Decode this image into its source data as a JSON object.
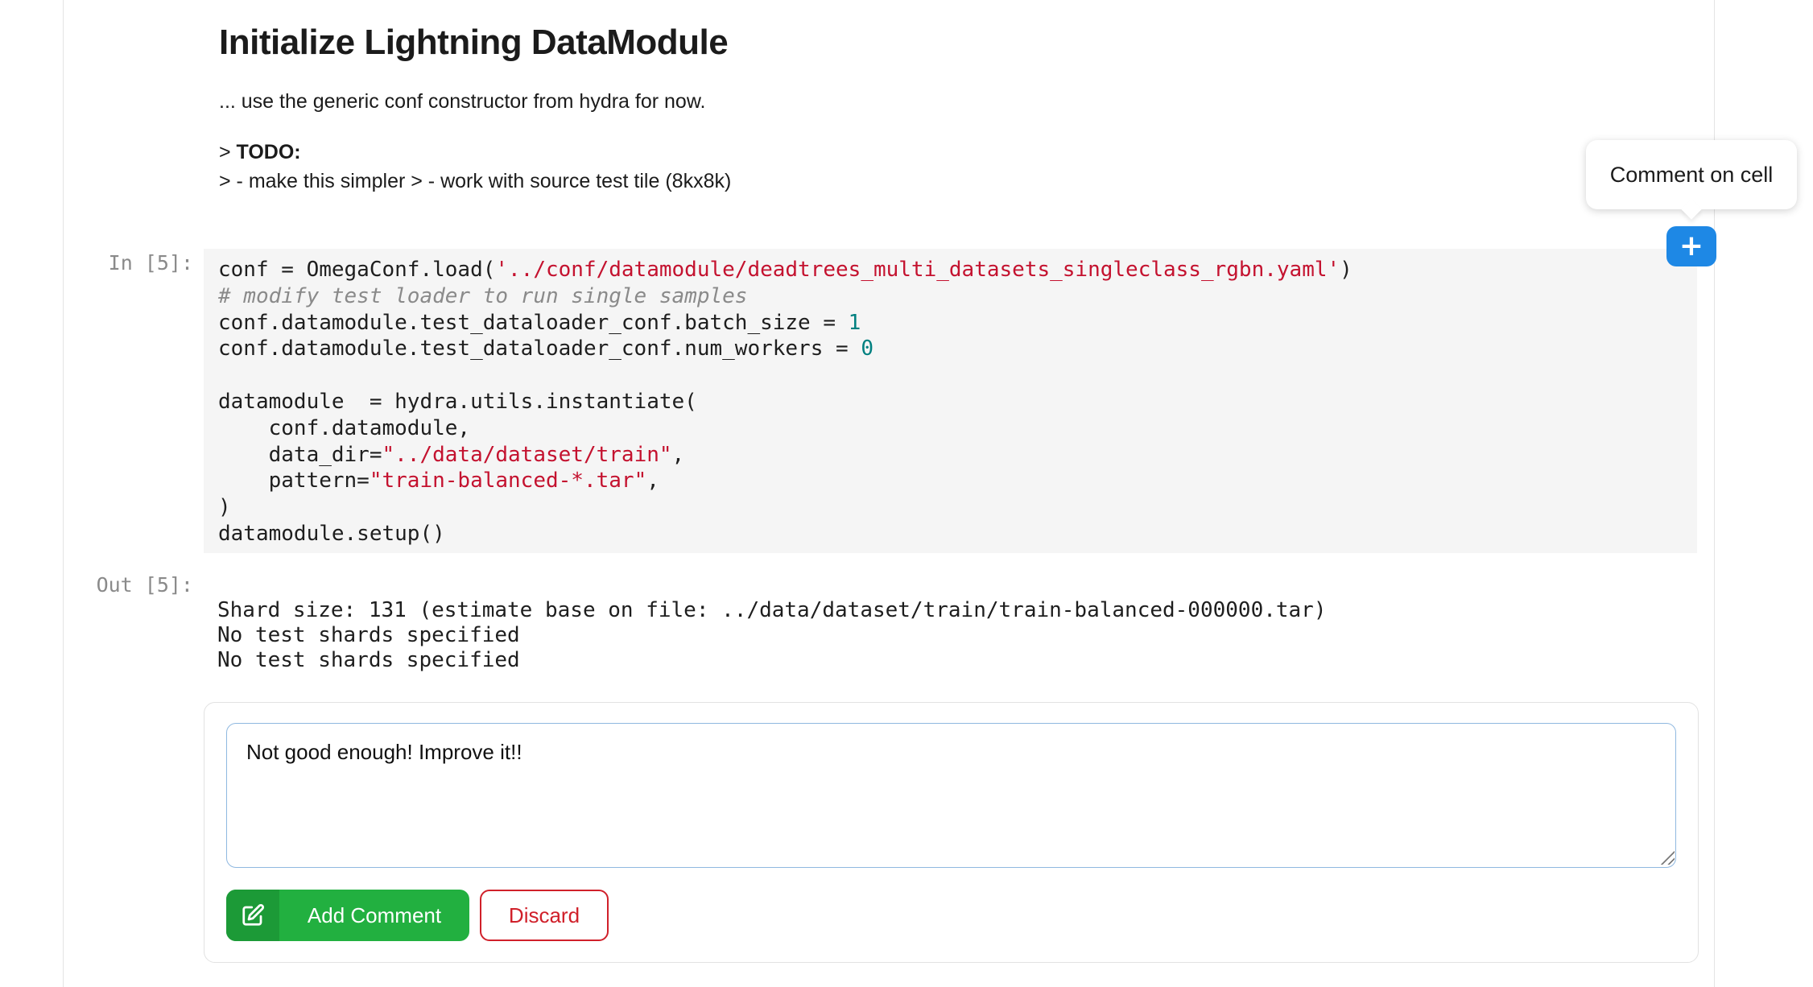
{
  "markdown": {
    "title": "Initialize Lightning DataModule",
    "subtitle": "... use the generic conf constructor from hydra for now.",
    "todo_prefix": "> ",
    "todo_label": "TODO:",
    "todo_items": "> - make this simpler > - work with source test tile (8kx8k)"
  },
  "cell": {
    "in_prompt": "In [5]:",
    "out_prompt": "Out [5]:",
    "code": {
      "l1_a": "conf = OmegaConf.load(",
      "l1_s": "'../conf/datamodule/deadtrees_multi_datasets_singleclass_rgbn.yaml'",
      "l1_b": ")",
      "l2_c": "# modify test loader to run single samples",
      "l3_a": "conf.datamodule.test_dataloader_conf.batch_size = ",
      "l3_n": "1",
      "l4_a": "conf.datamodule.test_dataloader_conf.num_workers = ",
      "l4_n": "0",
      "l6": "datamodule  = hydra.utils.instantiate(",
      "l7": "    conf.datamodule,",
      "l8_a": "    data_dir=",
      "l8_s": "\"../data/dataset/train\"",
      "l8_b": ",",
      "l9_a": "    pattern=",
      "l9_s": "\"train-balanced-*.tar\"",
      "l9_b": ",",
      "l10": ")",
      "l11": "datamodule.setup()"
    },
    "output_lines": [
      "Shard size: 131 (estimate base on file: ../data/dataset/train/train-balanced-000000.tar)",
      "No test shards specified",
      "No test shards specified"
    ]
  },
  "comment": {
    "text": "Not good enough! Improve it!!",
    "add_label": "Add Comment",
    "discard_label": "Discard",
    "add_icon": "edit-icon"
  },
  "tooltip": {
    "text": "Comment on cell"
  },
  "plus_button": {
    "label": "+",
    "icon": "plus-icon"
  },
  "colors": {
    "string": "#c4122f",
    "number": "#008080",
    "comment": "#8a8a8a",
    "add_button": "#22b040",
    "discard": "#d0202a",
    "plus_button": "#1e88e5"
  }
}
